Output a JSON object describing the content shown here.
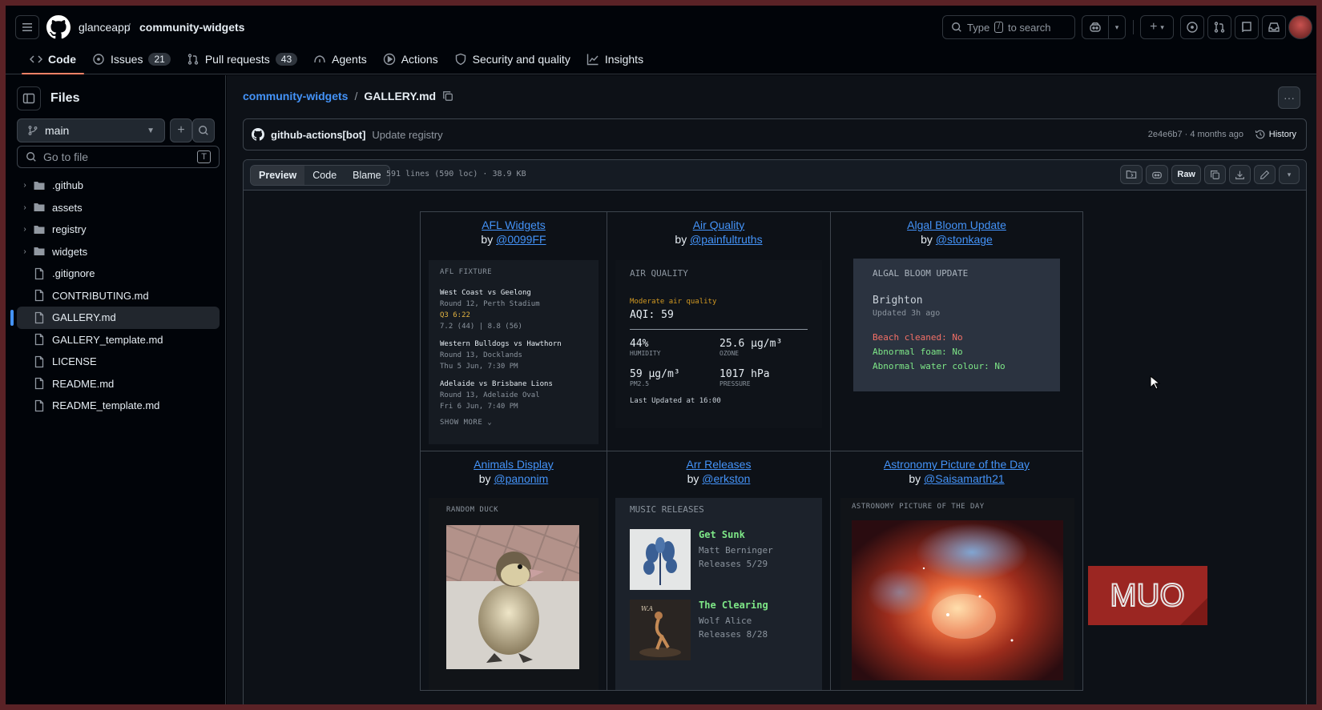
{
  "header": {
    "owner": "glanceapp",
    "sep": "/",
    "repo": "community-widgets",
    "search_prefix": "Type",
    "search_key": "/",
    "search_suffix": "to search",
    "tabs": [
      {
        "label": "Code",
        "count": null
      },
      {
        "label": "Issues",
        "count": "21"
      },
      {
        "label": "Pull requests",
        "count": "43"
      },
      {
        "label": "Agents",
        "count": null
      },
      {
        "label": "Actions",
        "count": null
      },
      {
        "label": "Security and quality",
        "count": null
      },
      {
        "label": "Insights",
        "count": null
      }
    ]
  },
  "sidebar": {
    "title": "Files",
    "branch": "main",
    "goto_placeholder": "Go to file",
    "goto_key": "T",
    "items": [
      {
        "label": ".github",
        "type": "dir"
      },
      {
        "label": "assets",
        "type": "dir"
      },
      {
        "label": "registry",
        "type": "dir"
      },
      {
        "label": "widgets",
        "type": "dir"
      },
      {
        "label": ".gitignore",
        "type": "file"
      },
      {
        "label": "CONTRIBUTING.md",
        "type": "file"
      },
      {
        "label": "GALLERY.md",
        "type": "file",
        "selected": true
      },
      {
        "label": "GALLERY_template.md",
        "type": "file"
      },
      {
        "label": "LICENSE",
        "type": "file"
      },
      {
        "label": "README.md",
        "type": "file"
      },
      {
        "label": "README_template.md",
        "type": "file"
      }
    ]
  },
  "main": {
    "path_repo": "community-widgets",
    "path_sep": "/",
    "path_file": "GALLERY.md",
    "commit": {
      "author": "github-actions[bot]",
      "message": "Update registry",
      "meta": "2e4e6b7 · 4 months ago",
      "history": "History"
    },
    "view_tabs": [
      "Preview",
      "Code",
      "Blame"
    ],
    "file_info": "591 lines (590 loc) · 38.9 KB",
    "raw": "Raw"
  },
  "gallery": {
    "by": "by",
    "cells": [
      {
        "title": "AFL Widgets",
        "author": "@0099FF"
      },
      {
        "title": "Air Quality",
        "author": "@painfultruths"
      },
      {
        "title": "Algal Bloom Update",
        "author": "@stonkage"
      },
      {
        "title": "Animals Display",
        "author": "@panonim"
      },
      {
        "title": "Arr Releases",
        "author": "@erkston"
      },
      {
        "title": "Astronomy Picture of the Day",
        "author": "@Saisamarth21"
      }
    ],
    "afl": {
      "head": "AFL FIXTURE",
      "games": [
        {
          "match": "West Coast vs Geelong",
          "venue": "Round 12, Perth Stadium",
          "live": "Q3 6:22",
          "info": "7.2 (44) | 8.8 (56)"
        },
        {
          "match": "Western Bulldogs vs Hawthorn",
          "venue": "Round 13, Docklands",
          "live": "",
          "info": "Thu 5 Jun, 7:30 PM"
        },
        {
          "match": "Adelaide vs Brisbane Lions",
          "venue": "Round 13, Adelaide Oval",
          "live": "",
          "info": "Fri 6 Jun, 7:40 PM"
        }
      ],
      "more": "SHOW MORE"
    },
    "aq": {
      "head": "AIR QUALITY",
      "status": "Moderate air quality",
      "aqi": "AQI: 59",
      "humidity": "44%",
      "humidity_label": "HUMIDITY",
      "ozone": "25.6 µg/m³",
      "ozone_label": "OZONE",
      "pm": "59 µg/m³",
      "pm_label": "PM2.5",
      "pressure": "1017 hPa",
      "pressure_label": "PRESSURE",
      "updated": "Last Updated at 16:00"
    },
    "algal": {
      "head": "ALGAL BLOOM UPDATE",
      "place": "Brighton",
      "updated": "Updated 3h ago",
      "l1": "Beach cleaned: No",
      "l2": "Abnormal foam: No",
      "l3": "Abnormal water colour: No"
    },
    "animal": {
      "head": "RANDOM DUCK"
    },
    "music": {
      "head": "MUSIC RELEASES",
      "items": [
        {
          "name": "Get Sunk",
          "artist": "Matt Berninger",
          "date": "Releases 5/29"
        },
        {
          "name": "The Clearing",
          "artist": "Wolf Alice",
          "date": "Releases 8/28"
        }
      ]
    },
    "apod": {
      "head": "ASTRONOMY PICTURE OF THE DAY"
    }
  },
  "watermark": "MUO",
  "colors": {
    "accent": "#4493f8",
    "tab_underline": "#f78166",
    "good": "#7ee787",
    "bad": "#f47067"
  }
}
